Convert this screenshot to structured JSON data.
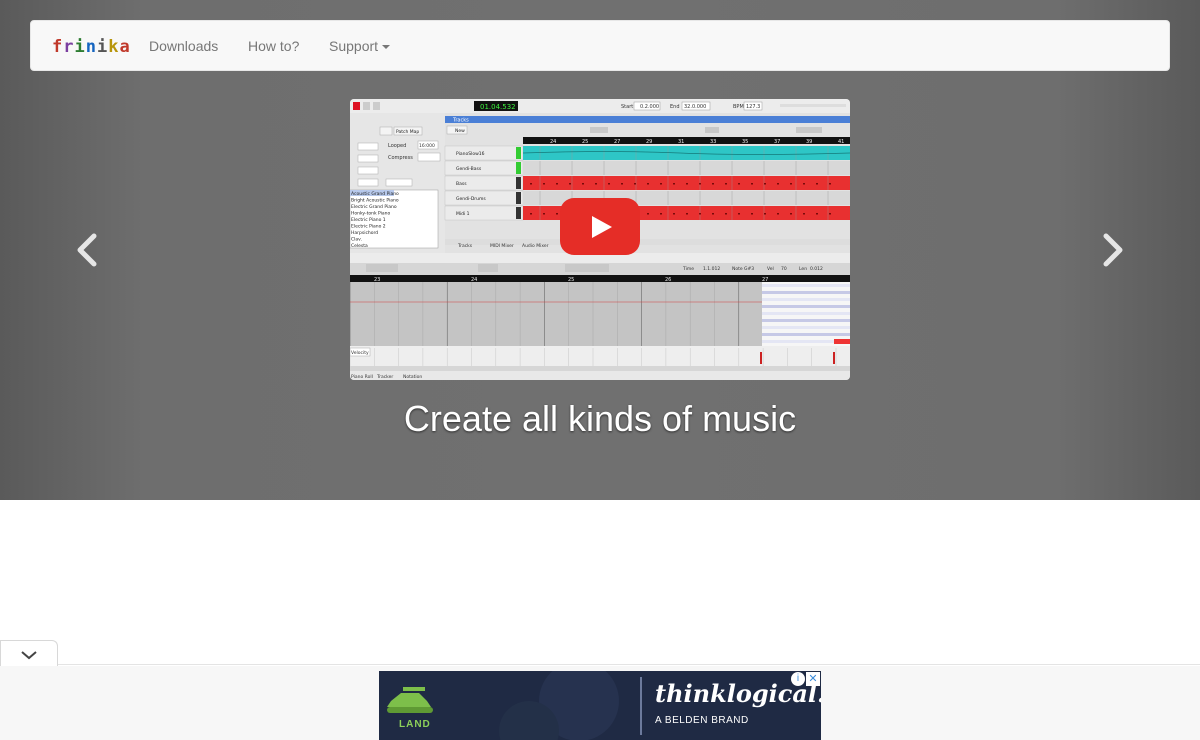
{
  "navbar": {
    "logo_text": "frinika",
    "links": [
      {
        "label": "Downloads"
      },
      {
        "label": "How to?"
      },
      {
        "label": "Support"
      }
    ]
  },
  "hero": {
    "caption": "Create all kinds of music",
    "video": {
      "transport_time": "01.04.532",
      "start_label": "Start",
      "start_value": "0.2.000",
      "end_label": "End",
      "end_value": "32.0.000",
      "bpm_label": "BPM",
      "bpm_value": "127.3",
      "tracks_tab": "Tracks",
      "new_button": "New",
      "tracks": [
        {
          "name": "PianoSlow16",
          "color": "#2ec6c6"
        },
        {
          "name": "Gendi-Bass",
          "color": "#d8d8d8"
        },
        {
          "name": "Bass",
          "color": "#e83030"
        },
        {
          "name": "Gendi-Drums",
          "color": "#d8d8d8"
        },
        {
          "name": "Midi 1",
          "color": "#e83030"
        }
      ],
      "ruler_marks": [
        "24",
        "25",
        "27",
        "29",
        "31",
        "33",
        "35",
        "37",
        "39",
        "41"
      ],
      "pianoroll_marks": [
        "23",
        "24",
        "25",
        "26",
        "27"
      ],
      "left_panel": {
        "looped_label": "Looped",
        "looped_value": "16:000",
        "compress_label": "Compress",
        "patch_button": "Patch Map",
        "instruments": [
          "Acoustic Grand Piano",
          "Bright Acoustic Piano",
          "Electric Grand Piano",
          "Honky-tonk Piano",
          "Electric Piano 1",
          "Electric Piano 2",
          "Harpsichord",
          "Clav.",
          "Celesta"
        ]
      },
      "bottom_tabs": [
        "Tracks",
        "MIDI Mixer",
        "Audio Mixer"
      ],
      "editor_tabs": [
        "Piano Roll",
        "Tracker",
        "Notation"
      ],
      "velocity_label": "Velocity",
      "time_label": "Time",
      "time_value": "1.1.012",
      "note_label": "Note",
      "note_value": "G#3",
      "vel_label": "Vel",
      "vel_value": "70",
      "len_label": "Len",
      "len_value": "0.012"
    }
  },
  "ad": {
    "brand": "thinklogical.",
    "sub": "A BELDEN BRAND",
    "land": "LAND",
    "info_icon": "i",
    "close_icon": "✕"
  },
  "colors": {
    "hero_bg": "#707070",
    "navbar_bg": "#f8f8f8",
    "nav_link": "#777777",
    "play_button": "#e52d27",
    "ad_bg": "#1f2a44"
  }
}
